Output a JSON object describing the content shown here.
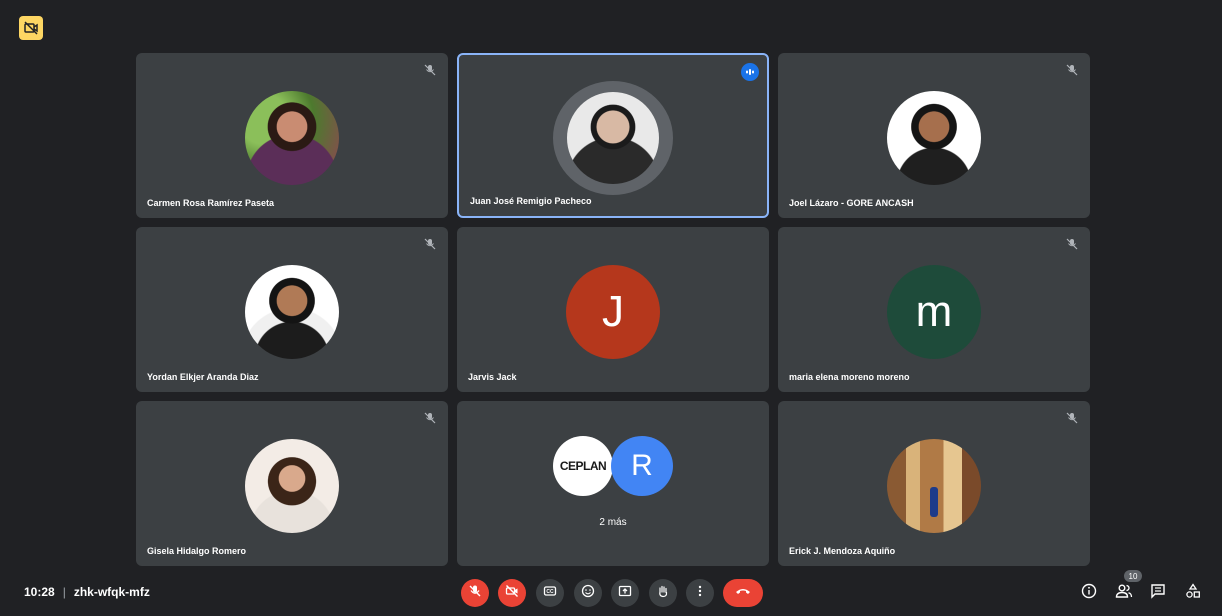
{
  "meeting": {
    "time": "10:28",
    "separator": "|",
    "code": "zhk-wfqk-mfz"
  },
  "participant_count": "10",
  "tiles": [
    {
      "name": "Carmen Rosa Ramírez Paseta"
    },
    {
      "name": "Juan José Remigio Pacheco"
    },
    {
      "name": "Joel Lázaro - GORE ANCASH"
    },
    {
      "name": "Yordan Elkjer Aranda Diaz"
    },
    {
      "name": "Jarvis Jack",
      "initial": "J"
    },
    {
      "name": "maria elena moreno moreno",
      "initial": "m"
    },
    {
      "name": "Gisela Hidalgo Romero"
    },
    {
      "more_label": "2 más",
      "logo_text": "CEPLAN",
      "initial": "R"
    },
    {
      "name": "Erick J. Mendoza Aquiño"
    }
  ],
  "colors": {
    "background": "#202124",
    "tile": "#3c4043",
    "active_border": "#8ab4f8",
    "danger": "#ea4335",
    "jarvis_avatar": "#b5371c",
    "maria_avatar": "#1e4b3a",
    "r_avatar": "#4285f4"
  },
  "icons": {
    "tile_status": "mic-off-icon",
    "speaking": "speaking-indicator-icon",
    "controls": [
      "mic-off-icon",
      "camera-off-icon",
      "captions-icon",
      "emoji-icon",
      "present-icon",
      "raise-hand-icon",
      "more-options-icon",
      "leave-call-icon"
    ],
    "right": [
      "info-icon",
      "people-icon",
      "chat-icon",
      "activities-icon"
    ]
  }
}
